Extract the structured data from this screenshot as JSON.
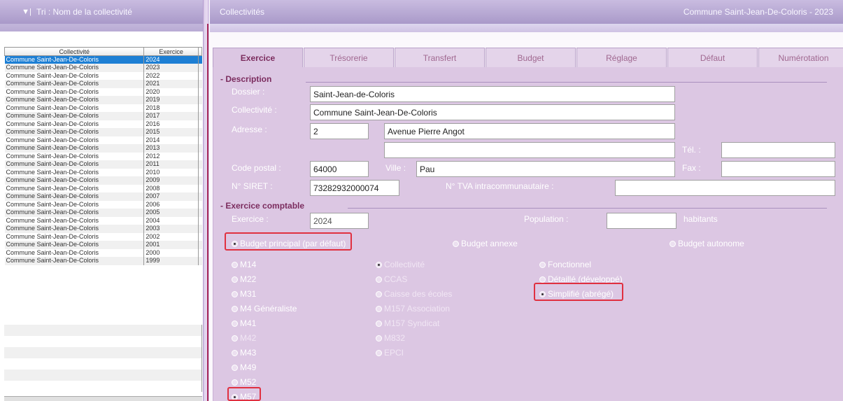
{
  "left_header": {
    "sort_label": "Tri : Nom de la collectivité"
  },
  "list": {
    "headers": [
      "Collectivité",
      "Exercice"
    ],
    "rows": [
      {
        "name": "Commune Saint-Jean-De-Coloris",
        "year": "2024",
        "selected": true
      },
      {
        "name": "Commune Saint-Jean-De-Coloris",
        "year": "2023"
      },
      {
        "name": "Commune Saint-Jean-De-Coloris",
        "year": "2022"
      },
      {
        "name": "Commune Saint-Jean-De-Coloris",
        "year": "2021"
      },
      {
        "name": "Commune Saint-Jean-De-Coloris",
        "year": "2020"
      },
      {
        "name": "Commune Saint-Jean-De-Coloris",
        "year": "2019"
      },
      {
        "name": "Commune Saint-Jean-De-Coloris",
        "year": "2018"
      },
      {
        "name": "Commune Saint-Jean-De-Coloris",
        "year": "2017"
      },
      {
        "name": "Commune Saint-Jean-De-Coloris",
        "year": "2016"
      },
      {
        "name": "Commune Saint-Jean-De-Coloris",
        "year": "2015"
      },
      {
        "name": "Commune Saint-Jean-De-Coloris",
        "year": "2014"
      },
      {
        "name": "Commune Saint-Jean-De-Coloris",
        "year": "2013"
      },
      {
        "name": "Commune Saint-Jean-De-Coloris",
        "year": "2012"
      },
      {
        "name": "Commune Saint-Jean-De-Coloris",
        "year": "2011"
      },
      {
        "name": "Commune Saint-Jean-De-Coloris",
        "year": "2010"
      },
      {
        "name": "Commune Saint-Jean-De-Coloris",
        "year": "2009"
      },
      {
        "name": "Commune Saint-Jean-De-Coloris",
        "year": "2008"
      },
      {
        "name": "Commune Saint-Jean-De-Coloris",
        "year": "2007"
      },
      {
        "name": "Commune Saint-Jean-De-Coloris",
        "year": "2006"
      },
      {
        "name": "Commune Saint-Jean-De-Coloris",
        "year": "2005"
      },
      {
        "name": "Commune Saint-Jean-De-Coloris",
        "year": "2004"
      },
      {
        "name": "Commune Saint-Jean-De-Coloris",
        "year": "2003"
      },
      {
        "name": "Commune Saint-Jean-De-Coloris",
        "year": "2002"
      },
      {
        "name": "Commune Saint-Jean-De-Coloris",
        "year": "2001"
      },
      {
        "name": "Commune Saint-Jean-De-Coloris",
        "year": "2000"
      },
      {
        "name": "Commune Saint-Jean-De-Coloris",
        "year": "1999"
      }
    ]
  },
  "right_header": {
    "title": "Collectivités",
    "context": "Commune Saint-Jean-De-Coloris - 2023"
  },
  "tabs": [
    "Exercice",
    "Trésorerie",
    "Transfert",
    "Budget",
    "Réglage",
    "Défaut",
    "Numérotation"
  ],
  "description": {
    "title": "- Description",
    "dossier_label": "Dossier :",
    "dossier_value": "Saint-Jean-de-Coloris",
    "collectivite_label": "Collectivité :",
    "collectivite_value": "Commune Saint-Jean-De-Coloris",
    "adresse_label": "Adresse :",
    "adresse_num": "2",
    "adresse_voie": "Avenue Pierre Angot",
    "adresse_line2": "",
    "tel_label": "Tél. :",
    "tel_value": "",
    "cp_label": "Code postal :",
    "cp_value": "64000",
    "ville_label": "Ville :",
    "ville_value": "Pau",
    "fax_label": "Fax :",
    "fax_value": "",
    "siret_label": "N° SIRET :",
    "siret_value": "73282932000074",
    "tva_label": "N° TVA intracommunautaire :",
    "tva_value": ""
  },
  "exercice": {
    "title": "- Exercice comptable",
    "exercice_label": "Exercice :",
    "exercice_value": "2024",
    "population_label": "Population :",
    "population_value": "",
    "habitants_label": "habitants",
    "budget_principal": "Budget principal (par défaut)",
    "budget_annexe": "Budget annexe",
    "budget_autonome": "Budget autonome"
  },
  "nomenclatures": [
    "M14",
    "M22",
    "M31",
    "M4 Généraliste",
    "M41",
    "M42",
    "M43",
    "M49",
    "M52",
    "M57"
  ],
  "categories": [
    "Collectivité",
    "CCAS",
    "Caisse des écoles",
    "M157 Association",
    "M157 Syndicat",
    "M832",
    "EPCI"
  ],
  "presentation": [
    "Fonctionnel",
    "Détaillé (développé)",
    "Simplifié (abrégé)"
  ],
  "colors": {
    "accent": "#7b2c5e",
    "panel": "#dcc7e3",
    "selection": "#1d7fd4",
    "highlight": "#e03040"
  }
}
